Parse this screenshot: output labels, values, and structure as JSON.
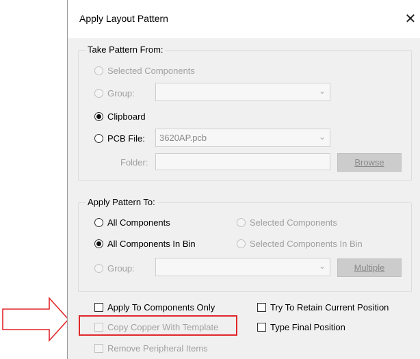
{
  "dialog": {
    "title": "Apply Layout Pattern",
    "close_symbol": "✕"
  },
  "take_pattern": {
    "legend": "Take Pattern From:",
    "selected_components": "Selected Components",
    "group_label": "Group:",
    "group_value": "",
    "clipboard": "Clipboard",
    "pcb_file_label": "PCB File:",
    "pcb_file_value": "3620AP.pcb",
    "folder_label": "Folder:",
    "folder_value": "",
    "browse_button": "Browse",
    "selected": "Clipboard"
  },
  "apply_pattern": {
    "legend": "Apply Pattern To:",
    "all_components": "All Components",
    "selected_components": "Selected Components",
    "all_components_in_bin": "All Components In Bin",
    "selected_components_in_bin": "Selected Components In Bin",
    "group_label": "Group:",
    "group_value": "",
    "multiple_button": "Multiple",
    "selected": "All Components In Bin"
  },
  "options": {
    "apply_to_components_only": "Apply To Components Only",
    "copy_copper_with_template": "Copy Copper With Template",
    "remove_peripheral_items": "Remove Peripheral Items",
    "try_to_retain_current_position": "Try To Retain Current Position",
    "type_final_position": "Type Final Position"
  },
  "annotation": {
    "arrow_color": "#e0272a",
    "highlight_color": "#e0272a"
  },
  "icons": {
    "close": "close-icon",
    "dropdown": "chevron-down-icon",
    "arrow": "right-arrow-icon"
  }
}
